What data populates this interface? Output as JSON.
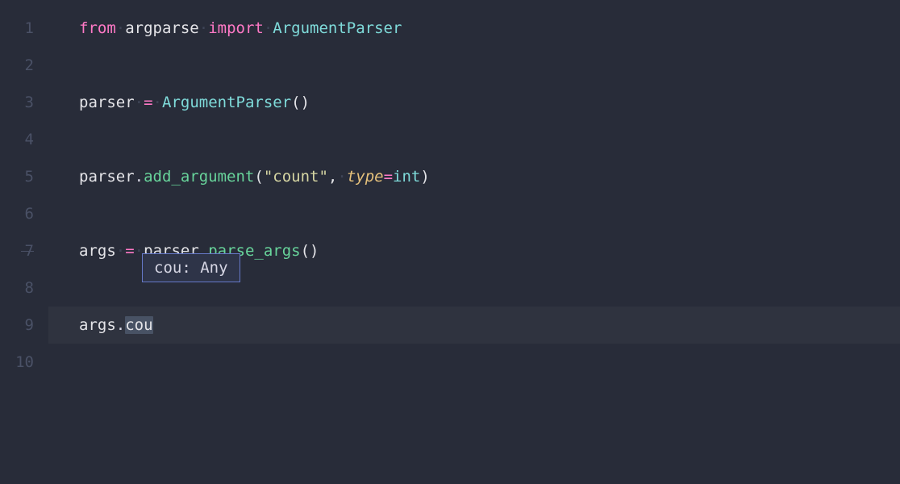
{
  "line_numbers": [
    "1",
    "2",
    "3",
    "4",
    "5",
    "6",
    "7",
    "8",
    "9",
    "10"
  ],
  "code": {
    "l1": {
      "from": "from",
      "module": "argparse",
      "import": "import",
      "cls": "ArgumentParser"
    },
    "l3": {
      "var": "parser",
      "eq": "=",
      "cls": "ArgumentParser",
      "paren": "()"
    },
    "l5": {
      "obj": "parser",
      "dot": ".",
      "method": "add_argument",
      "lp": "(",
      "str": "\"count\"",
      "comma": ",",
      "param": "type",
      "eq": "=",
      "type": "int",
      "rp": ")"
    },
    "l7": {
      "var": "args",
      "eq": "=",
      "obj": "parser",
      "dot": ".",
      "method": "parse_args",
      "paren": "()"
    },
    "l9": {
      "obj": "args",
      "dot": ".",
      "partial": "cou"
    }
  },
  "completion": {
    "text": "cou: Any"
  }
}
